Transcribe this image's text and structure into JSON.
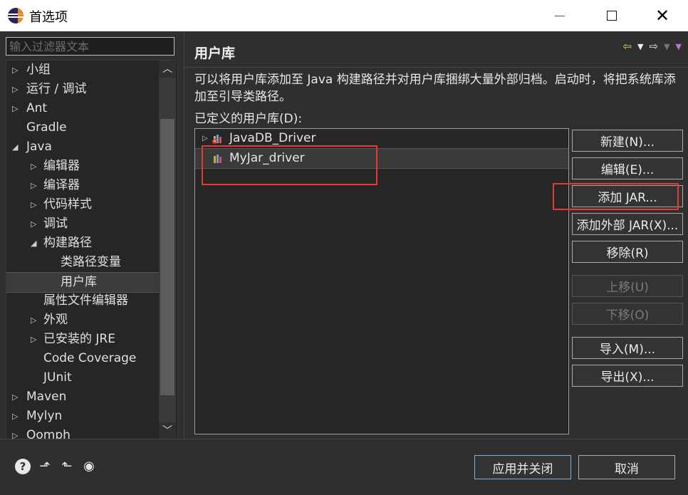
{
  "window": {
    "title": "首选项"
  },
  "filter": {
    "placeholder": "输入过滤器文本"
  },
  "tree": {
    "items": [
      {
        "label": "小组",
        "expander": "▷"
      },
      {
        "label": "运行 / 调试",
        "expander": "▷"
      },
      {
        "label": "Ant",
        "expander": "▷"
      },
      {
        "label": "Gradle",
        "expander": ""
      },
      {
        "label": "Java",
        "expander": "◢"
      },
      {
        "label": "编辑器",
        "expander": "▷"
      },
      {
        "label": "编译器",
        "expander": "▷"
      },
      {
        "label": "代码样式",
        "expander": "▷"
      },
      {
        "label": "调试",
        "expander": "▷"
      },
      {
        "label": "构建路径",
        "expander": "◢"
      },
      {
        "label": "类路径变量",
        "expander": ""
      },
      {
        "label": "用户库",
        "expander": ""
      },
      {
        "label": "属性文件编辑器",
        "expander": ""
      },
      {
        "label": "外观",
        "expander": "▷"
      },
      {
        "label": "已安装的 JRE",
        "expander": "▷"
      },
      {
        "label": "Code Coverage",
        "expander": ""
      },
      {
        "label": "JUnit",
        "expander": ""
      },
      {
        "label": "Maven",
        "expander": "▷"
      },
      {
        "label": "Mylyn",
        "expander": "▷"
      },
      {
        "label": "Oomph",
        "expander": "▷"
      }
    ]
  },
  "page": {
    "title": "用户库",
    "description": "可以将用户库添加至 Java 构建路径并对用户库捆绑大量外部归档。启动时，将把系统库添加至引导类路径。",
    "defined_label": "已定义的用户库(D):"
  },
  "libraries": [
    {
      "label": "JavaDB_Driver",
      "has_error": true
    },
    {
      "label": "MyJar_driver",
      "has_error": false
    }
  ],
  "buttons": {
    "new": "新建(N)...",
    "edit": "编辑(E)...",
    "add_jar": "添加 JAR...",
    "add_external_jar": "添加外部 JAR(X)...",
    "remove": "移除(R)",
    "move_up": "上移(U)",
    "move_down": "下移(O)",
    "import": "导入(M)...",
    "export": "导出(X)..."
  },
  "footer": {
    "apply_close": "应用并关闭",
    "cancel": "取消"
  },
  "icons": {
    "help": "?",
    "import": "⬏",
    "export": "⬑",
    "oomph": "◉"
  },
  "colors": {
    "highlight": "#e53935",
    "background": "#2f2f2f"
  }
}
